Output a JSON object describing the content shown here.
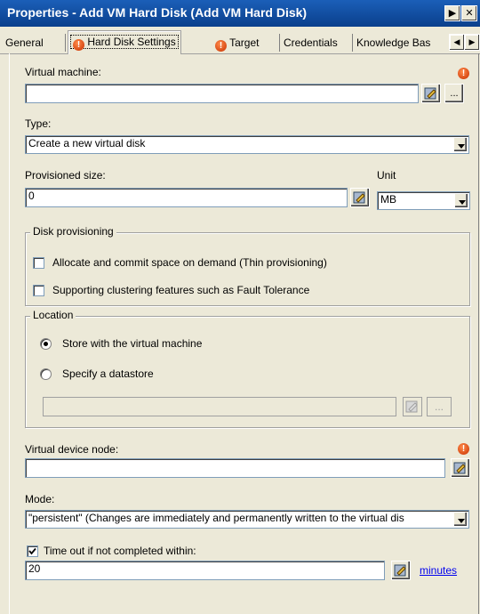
{
  "window": {
    "title": "Properties - Add VM Hard Disk (Add VM Hard Disk)",
    "help_button": "▶",
    "close_button": "✕"
  },
  "tabs": [
    {
      "label": "General",
      "error": false
    },
    {
      "label": "Hard Disk Settings",
      "error": true,
      "selected": true
    },
    {
      "label": "Target",
      "error": true
    },
    {
      "label": "Credentials",
      "error": false
    },
    {
      "label": "Knowledge Bas",
      "error": false
    }
  ],
  "tab_scroll": {
    "left": "◀",
    "right": "▶"
  },
  "virtual_machine": {
    "label": "Virtual machine:",
    "value": "",
    "browse_label": "..."
  },
  "type": {
    "label": "Type:",
    "value": "Create a new virtual disk"
  },
  "provisioned_size": {
    "label": "Provisioned size:",
    "value": "0"
  },
  "unit": {
    "label": "Unit",
    "value": "MB"
  },
  "disk_provisioning": {
    "legend": "Disk provisioning",
    "thin": {
      "label": "Allocate and commit space on demand (Thin provisioning)",
      "checked": false
    },
    "clustering": {
      "label": "Supporting clustering features such as Fault Tolerance",
      "checked": false
    }
  },
  "location": {
    "legend": "Location",
    "store_with_vm": {
      "label": "Store with the virtual machine",
      "selected": true
    },
    "specify_datastore": {
      "label": "Specify a datastore",
      "selected": false
    },
    "datastore_value": "",
    "browse_label": "..."
  },
  "virtual_device_node": {
    "label": "Virtual device node:",
    "value": ""
  },
  "mode": {
    "label": "Mode:",
    "value": "\"persistent\" (Changes are immediately and permanently written to the virtual dis"
  },
  "timeout": {
    "label": "Time out if not completed within:",
    "checked": true,
    "value": "20",
    "unit_link": "minutes"
  },
  "colors": {
    "titlebar": "#0a3f8c",
    "error": "#d94010",
    "link": "#0000ee",
    "window": "#ece9d8"
  },
  "icons": {
    "error": "error-icon",
    "variable": "variable-icon"
  }
}
